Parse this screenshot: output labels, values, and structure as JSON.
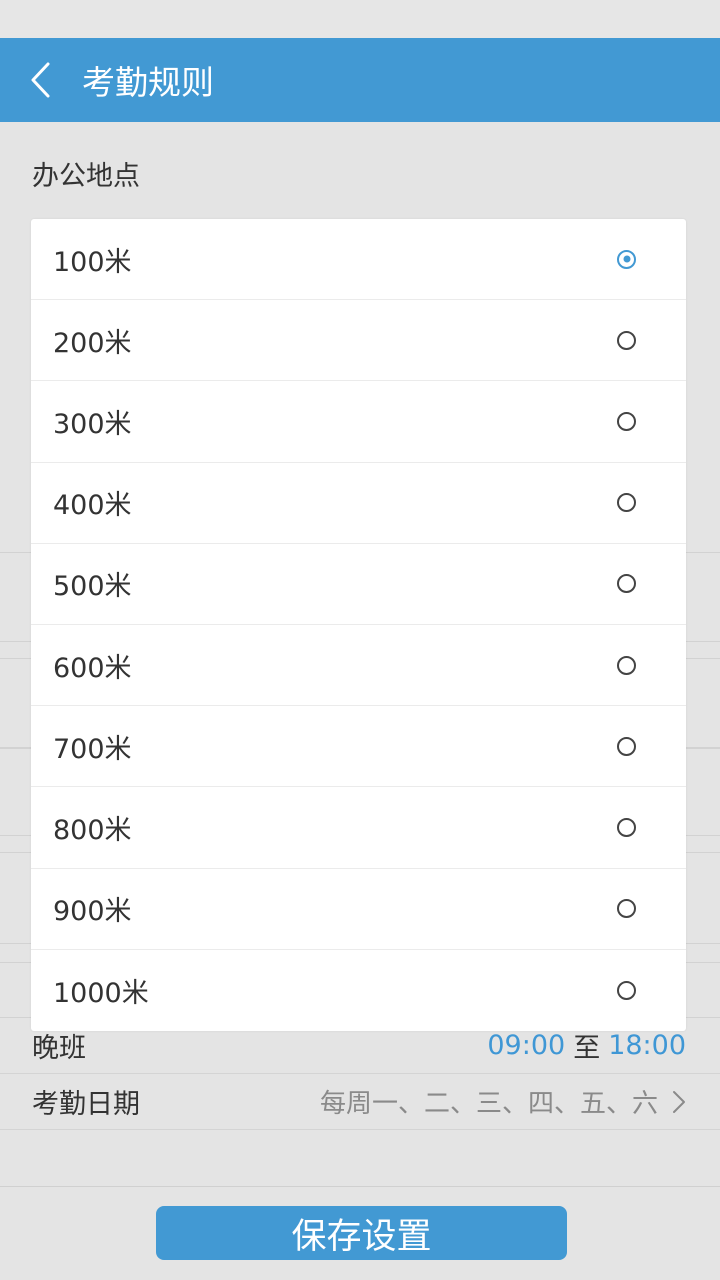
{
  "header": {
    "title": "考勤规则",
    "back_icon": "chevron-left-icon"
  },
  "section": {
    "title": "办公地点"
  },
  "dialog": {
    "options": [
      {
        "label": "100米",
        "selected": true
      },
      {
        "label": "200米",
        "selected": false
      },
      {
        "label": "300米",
        "selected": false
      },
      {
        "label": "400米",
        "selected": false
      },
      {
        "label": "500米",
        "selected": false
      },
      {
        "label": "600米",
        "selected": false
      },
      {
        "label": "700米",
        "selected": false
      },
      {
        "label": "800米",
        "selected": false
      },
      {
        "label": "900米",
        "selected": false
      },
      {
        "label": "1000米",
        "selected": false
      }
    ]
  },
  "rows": {
    "night_shift": {
      "label": "晚班",
      "start": "09:00",
      "separator": "至",
      "end": "18:00"
    },
    "attendance_date": {
      "label": "考勤日期",
      "value": "每周一、二、三、四、五、六",
      "icon": "chevron-right-icon"
    }
  },
  "footer": {
    "save_label": "保存设置"
  },
  "colors": {
    "accent": "#4299d3",
    "time_text": "#3f97d5",
    "background": "#e4e4e4"
  }
}
